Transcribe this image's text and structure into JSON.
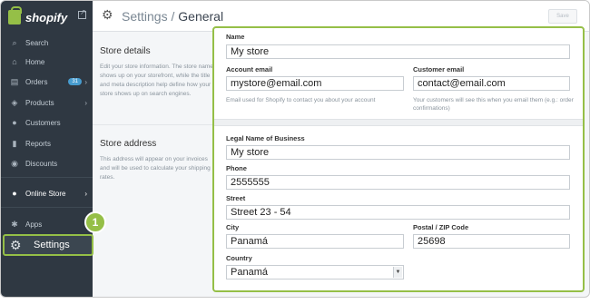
{
  "sidebar": {
    "brand": "shopify",
    "items": [
      {
        "label": "Search",
        "icon": "search-icon"
      },
      {
        "label": "Home",
        "icon": "home-icon"
      },
      {
        "label": "Orders",
        "icon": "orders-icon",
        "badge": "31"
      },
      {
        "label": "Products",
        "icon": "tag-icon"
      },
      {
        "label": "Customers",
        "icon": "customers-icon"
      },
      {
        "label": "Reports",
        "icon": "chart-icon"
      },
      {
        "label": "Discounts",
        "icon": "discount-icon"
      },
      {
        "label": "Online Store",
        "icon": "globe-icon"
      },
      {
        "label": "Apps",
        "icon": "apps-icon"
      },
      {
        "label": "Settings",
        "icon": "gear-icon"
      }
    ],
    "step_number": "1",
    "accent": "#95bf47"
  },
  "header": {
    "section": "Settings",
    "separator": " / ",
    "current": "General",
    "save_label": "Save"
  },
  "store_details": {
    "title": "Store details",
    "description": "Edit your store information. The store name shows up on your storefront, while the title and meta description help define how your store shows up on search engines."
  },
  "store_address": {
    "title": "Store address",
    "description": "This address will appear on your invoices and will be used to calculate your shipping rates."
  },
  "form": {
    "name_label": "Name",
    "name_value": "My store",
    "account_email_label": "Account email",
    "account_email_value": "mystore@email.com",
    "account_email_hint": "Email used for Shopify to contact you about your account",
    "customer_email_label": "Customer email",
    "customer_email_value": "contact@email.com",
    "customer_email_hint": "Your customers will see this when you email them (e.g.: order confirmations)",
    "legal_name_label": "Legal Name of Business",
    "legal_name_value": "My store",
    "phone_label": "Phone",
    "phone_value": "2555555",
    "street_label": "Street",
    "street_value": "Street 23 - 54",
    "city_label": "City",
    "city_value": "Panamá",
    "postal_label": "Postal / ZIP Code",
    "postal_value": "25698",
    "country_label": "Country",
    "country_value": "Panamá"
  }
}
